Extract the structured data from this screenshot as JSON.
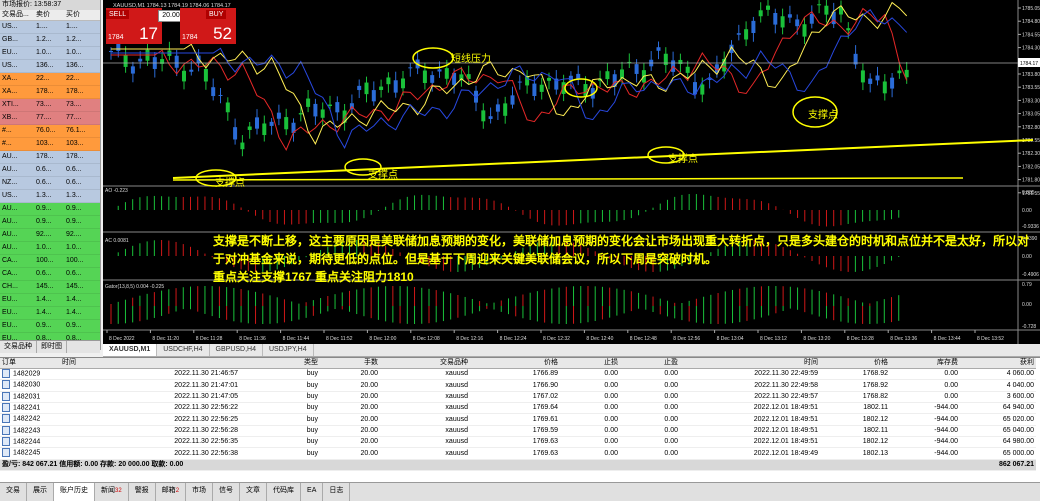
{
  "market_watch": {
    "title": "市场报价: 13:58:37",
    "columns": [
      "交易品...",
      "卖价",
      "买价"
    ],
    "rows": [
      {
        "symbol": "US...",
        "bid": "1....",
        "ask": "1....",
        "color": "#b8c9e0"
      },
      {
        "symbol": "GB...",
        "bid": "1.2...",
        "ask": "1.2...",
        "color": "#b8c9e0"
      },
      {
        "symbol": "EU...",
        "bid": "1.0...",
        "ask": "1.0...",
        "color": "#b8c9e0"
      },
      {
        "symbol": "US...",
        "bid": "136...",
        "ask": "136...",
        "color": "#b8c9e0"
      },
      {
        "symbol": "XA...",
        "bid": "22...",
        "ask": "22...",
        "color": "#ff9a3c"
      },
      {
        "symbol": "XA...",
        "bid": "178...",
        "ask": "178...",
        "color": "#ff9a3c"
      },
      {
        "symbol": "XTI...",
        "bid": "73....",
        "ask": "73....",
        "color": "#e08080"
      },
      {
        "symbol": "XB...",
        "bid": "77....",
        "ask": "77....",
        "color": "#e08080"
      },
      {
        "symbol": "#...",
        "bid": "76.0...",
        "ask": "76.1...",
        "color": "#ff9a3c"
      },
      {
        "symbol": "#...",
        "bid": "103...",
        "ask": "103...",
        "color": "#ff9a3c"
      },
      {
        "symbol": "AU...",
        "bid": "178...",
        "ask": "178...",
        "color": "#b8c9e0"
      },
      {
        "symbol": "AU...",
        "bid": "0.6...",
        "ask": "0.6...",
        "color": "#b8c9e0"
      },
      {
        "symbol": "NZ...",
        "bid": "0.6...",
        "ask": "0.6...",
        "color": "#b8c9e0"
      },
      {
        "symbol": "US...",
        "bid": "1.3...",
        "ask": "1.3...",
        "color": "#b8c9e0"
      },
      {
        "symbol": "AU...",
        "bid": "0.9...",
        "ask": "0.9...",
        "color": "#55d455"
      },
      {
        "symbol": "AU...",
        "bid": "0.9...",
        "ask": "0.9...",
        "color": "#55d455"
      },
      {
        "symbol": "AU...",
        "bid": "92....",
        "ask": "92....",
        "color": "#55d455"
      },
      {
        "symbol": "AU...",
        "bid": "1.0...",
        "ask": "1.0...",
        "color": "#55d455"
      },
      {
        "symbol": "CA...",
        "bid": "100...",
        "ask": "100...",
        "color": "#55d455"
      },
      {
        "symbol": "CA...",
        "bid": "0.6...",
        "ask": "0.6...",
        "color": "#55d455"
      },
      {
        "symbol": "CH...",
        "bid": "145...",
        "ask": "145...",
        "color": "#55d455"
      },
      {
        "symbol": "EU...",
        "bid": "1.4...",
        "ask": "1.4...",
        "color": "#55d455"
      },
      {
        "symbol": "EU...",
        "bid": "1.4...",
        "ask": "1.4...",
        "color": "#55d455"
      },
      {
        "symbol": "EU...",
        "bid": "0.9...",
        "ask": "0.9...",
        "color": "#55d455"
      },
      {
        "symbol": "EU...",
        "bid": "0.8...",
        "ask": "0.8...",
        "color": "#55d455"
      },
      {
        "symbol": "EU...",
        "bid": "144...",
        "ask": "144...",
        "color": "#55d455"
      },
      {
        "symbol": "EU...",
        "bid": "1.6...",
        "ask": "1.6...",
        "color": "#55d455"
      },
      {
        "symbol": "GB...",
        "bid": "1.8...",
        "ask": "1.8...",
        "color": "#55d455"
      }
    ],
    "tabs": [
      "交易品种",
      "即时图"
    ]
  },
  "chart": {
    "title": "XAUUSD,M1  1784.13 1784.19 1784.06 1784.17",
    "sell_label": "SELL",
    "buy_label": "BUY",
    "lot": "20.00",
    "sell_small": "1784",
    "sell_big": "17",
    "buy_small": "1784",
    "buy_big": "52",
    "price_labels": [
      "1785.05",
      "1784.80",
      "1784.55",
      "1784.30",
      "1784.05",
      "1783.80",
      "1783.55",
      "1783.30",
      "1783.05",
      "1782.80",
      "1782.55",
      "1782.30",
      "1782.05",
      "1781.80",
      "1781.55"
    ],
    "current_price": "1784.17",
    "annotations": {
      "resistance": "短线压力",
      "support1": "支撑点",
      "support2": "支撑点",
      "support3": "支撑点",
      "support4": "支撑点"
    },
    "ao_label": "AO -0.223",
    "ao_scale": [
      "0.835",
      "0.00",
      "-0.9336"
    ],
    "ac_label": "AC 0.0081",
    "ac_scale": [
      "0.4390",
      "0.00",
      "-0.4906"
    ],
    "gator_label": "Gator(13,8,5) 0.004 -0.225",
    "gator_scale": [
      "0.79",
      "0.00",
      "-0.728"
    ],
    "time_labels": [
      "8 Dec 2022",
      "8 Dec 11:20",
      "8 Dec 11:28",
      "8 Dec 11:36",
      "8 Dec 11:44",
      "8 Dec 11:52",
      "8 Dec 12:00",
      "8 Dec 12:08",
      "8 Dec 12:16",
      "8 Dec 12:24",
      "8 Dec 12:32",
      "8 Dec 12:40",
      "8 Dec 12:48",
      "8 Dec 12:56",
      "8 Dec 13:04",
      "8 Dec 13:12",
      "8 Dec 13:20",
      "8 Dec 13:28",
      "8 Dec 13:36",
      "8 Dec 13:44",
      "8 Dec 13:52"
    ],
    "commentary": "支撑是不断上移，这主要原因是美联储加息预期的变化，美联储加息预期的变化会让市场出现重大转折点，只是多头建仓的时机和点位并不是太好，所以对于对冲基金来说，期待更低的点位。但是基于下周迎来关键美联储会议，所以下周是突破时机。",
    "focus": "重点关注支撑1767 重点关注阻力1810",
    "tabs": [
      "XAUUSD,M1",
      "USDCHF,H4",
      "GBPUSD,H4",
      "USDJPY,H4"
    ]
  },
  "terminal": {
    "columns": [
      "订单",
      "时间",
      "类型",
      "手数",
      "交易品种",
      "价格",
      "止损",
      "止盈",
      "时间",
      "价格",
      "库存费",
      "获利"
    ],
    "rows": [
      [
        "1482029",
        "2022.11.30 21:46:57",
        "buy",
        "20.00",
        "xauusd",
        "1766.89",
        "0.00",
        "0.00",
        "2022.11.30 22:49:59",
        "1768.92",
        "0.00",
        "4 060.00"
      ],
      [
        "1482030",
        "2022.11.30 21:47:01",
        "buy",
        "20.00",
        "xauusd",
        "1766.90",
        "0.00",
        "0.00",
        "2022.11.30 22:49:58",
        "1768.92",
        "0.00",
        "4 040.00"
      ],
      [
        "1482031",
        "2022.11.30 21:47:05",
        "buy",
        "20.00",
        "xauusd",
        "1767.02",
        "0.00",
        "0.00",
        "2022.11.30 22:49:57",
        "1768.82",
        "0.00",
        "3 600.00"
      ],
      [
        "1482241",
        "2022.11.30 22:56:22",
        "buy",
        "20.00",
        "xauusd",
        "1769.64",
        "0.00",
        "0.00",
        "2022.12.01 18:49:51",
        "1802.11",
        "-944.00",
        "64 940.00"
      ],
      [
        "1482242",
        "2022.11.30 22:56:25",
        "buy",
        "20.00",
        "xauusd",
        "1769.61",
        "0.00",
        "0.00",
        "2022.12.01 18:49:51",
        "1802.12",
        "-944.00",
        "65 020.00"
      ],
      [
        "1482243",
        "2022.11.30 22:56:28",
        "buy",
        "20.00",
        "xauusd",
        "1769.59",
        "0.00",
        "0.00",
        "2022.12.01 18:49:51",
        "1802.11",
        "-944.00",
        "65 040.00"
      ],
      [
        "1482244",
        "2022.11.30 22:56:35",
        "buy",
        "20.00",
        "xauusd",
        "1769.63",
        "0.00",
        "0.00",
        "2022.12.01 18:49:51",
        "1802.12",
        "-944.00",
        "64 980.00"
      ],
      [
        "1482245",
        "2022.11.30 22:56:38",
        "buy",
        "20.00",
        "xauusd",
        "1769.63",
        "0.00",
        "0.00",
        "2022.12.01 18:49:49",
        "1802.13",
        "-944.00",
        "65 000.00"
      ]
    ],
    "total_text": "盈/亏: 842 067.21  信用额: 0.00  存款: 20 000.00  取款: 0.00",
    "total_value": "862 067.21",
    "tabs": [
      {
        "label": "交易",
        "badge": ""
      },
      {
        "label": "展示",
        "badge": ""
      },
      {
        "label": "账户历史",
        "badge": ""
      },
      {
        "label": "新闻",
        "badge": "32"
      },
      {
        "label": "警报",
        "badge": ""
      },
      {
        "label": "邮箱",
        "badge": "2"
      },
      {
        "label": "市场",
        "badge": ""
      },
      {
        "label": "信号",
        "badge": ""
      },
      {
        "label": "文章",
        "badge": ""
      },
      {
        "label": "代码库",
        "badge": ""
      },
      {
        "label": "EA",
        "badge": ""
      },
      {
        "label": "日志",
        "badge": ""
      }
    ]
  }
}
